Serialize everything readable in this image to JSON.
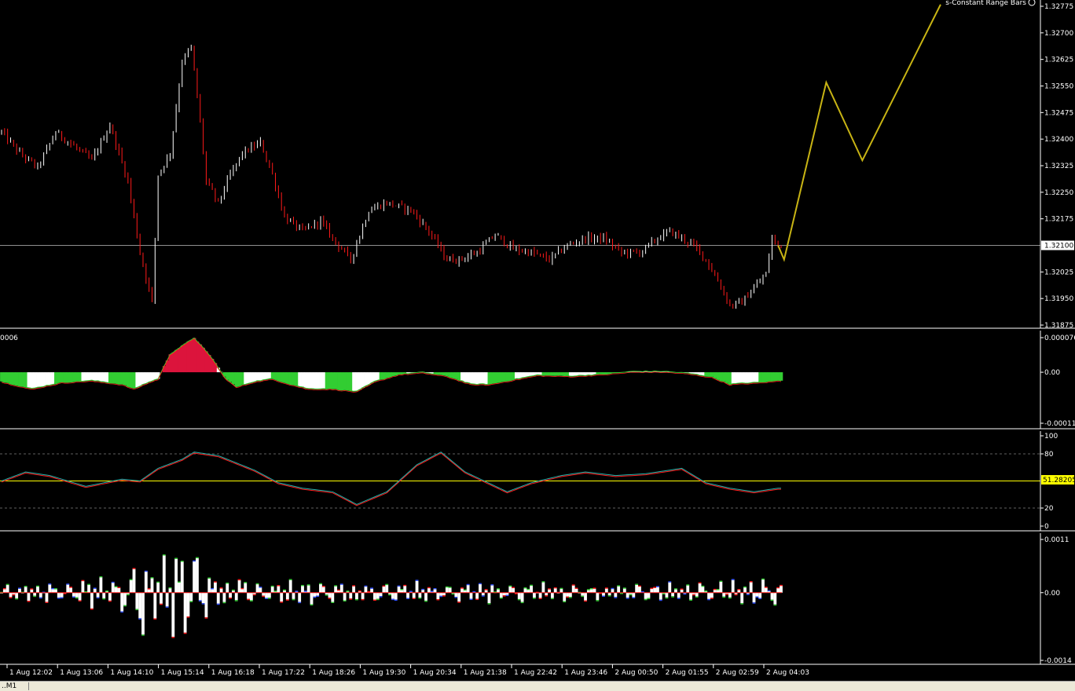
{
  "window": {
    "corner_title": "s-Constant Range Bars",
    "timeframe_tab": "..M1"
  },
  "colors": {
    "background": "#000000",
    "candle_up": "#ffffff",
    "candle_down": "#ff1a1a",
    "projection": "#c8b414",
    "hist_positive": "#dc143c",
    "hist_negative": "#32cd32",
    "hist_fill": "#ffffff",
    "signal_line": "#32cd32",
    "level_line": "#ffff00"
  },
  "chart_data": [
    {
      "type": "candlestick",
      "title": "s-Constant Range Bars",
      "ylim": [
        1.31875,
        1.32775
      ],
      "y_ticks": [
        "1.32775",
        "1.32700",
        "1.32625",
        "1.32550",
        "1.32475",
        "1.32400",
        "1.32325",
        "1.32250",
        "1.32175",
        "1.32025",
        "1.31950",
        "1.31875"
      ],
      "current_price": "1.32100",
      "bars": 260,
      "price_path": [
        [
          0,
          1.3242
        ],
        [
          6,
          1.3236
        ],
        [
          12,
          1.3232
        ],
        [
          18,
          1.3242
        ],
        [
          24,
          1.3238
        ],
        [
          30,
          1.3234
        ],
        [
          36,
          1.3244
        ],
        [
          42,
          1.3228
        ],
        [
          46,
          1.3208
        ],
        [
          50,
          1.3194
        ],
        [
          52,
          1.323
        ],
        [
          56,
          1.3236
        ],
        [
          60,
          1.3262
        ],
        [
          63,
          1.3266
        ],
        [
          66,
          1.3245
        ],
        [
          68,
          1.3228
        ],
        [
          72,
          1.3222
        ],
        [
          76,
          1.323
        ],
        [
          80,
          1.3236
        ],
        [
          86,
          1.3239
        ],
        [
          90,
          1.323
        ],
        [
          94,
          1.3218
        ],
        [
          100,
          1.3214
        ],
        [
          106,
          1.3217
        ],
        [
          110,
          1.3212
        ],
        [
          116,
          1.3206
        ],
        [
          122,
          1.322
        ],
        [
          128,
          1.3222
        ],
        [
          136,
          1.322
        ],
        [
          142,
          1.3214
        ],
        [
          148,
          1.3206
        ],
        [
          152,
          1.3206
        ],
        [
          158,
          1.3208
        ],
        [
          164,
          1.3213
        ],
        [
          170,
          1.3209
        ],
        [
          176,
          1.3208
        ],
        [
          182,
          1.3206
        ],
        [
          188,
          1.321
        ],
        [
          194,
          1.3212
        ],
        [
          200,
          1.3212
        ],
        [
          206,
          1.3208
        ],
        [
          212,
          1.3208
        ],
        [
          218,
          1.3212
        ],
        [
          222,
          1.3214
        ],
        [
          226,
          1.3212
        ],
        [
          230,
          1.321
        ],
        [
          234,
          1.3206
        ],
        [
          238,
          1.32
        ],
        [
          242,
          1.3193
        ],
        [
          246,
          1.3194
        ],
        [
          250,
          1.3198
        ],
        [
          254,
          1.3202
        ],
        [
          256,
          1.3212
        ],
        [
          258,
          1.321
        ]
      ],
      "projection_line": [
        [
          258,
          1.321
        ],
        [
          260,
          1.3206
        ],
        [
          274,
          1.3256
        ],
        [
          286,
          1.3234
        ],
        [
          312,
          1.3278
        ]
      ]
    },
    {
      "type": "histogram",
      "y_ticks": [
        "0.000076",
        "0.00",
        "-0.000112"
      ],
      "ylim": [
        -0.000112,
        7.6e-05
      ],
      "top_left_label": "0006",
      "oscillator_path": [
        [
          0,
          -2e-05
        ],
        [
          10,
          -3.6e-05
        ],
        [
          20,
          -2.2e-05
        ],
        [
          30,
          -1.8e-05
        ],
        [
          40,
          -2.6e-05
        ],
        [
          44,
          -3.6e-05
        ],
        [
          48,
          -2.4e-05
        ],
        [
          52,
          -1.4e-05
        ],
        [
          56,
          4e-05
        ],
        [
          64,
          7.6e-05
        ],
        [
          70,
          3e-05
        ],
        [
          74,
          -1e-05
        ],
        [
          78,
          -3.2e-05
        ],
        [
          84,
          -2e-05
        ],
        [
          90,
          -1.4e-05
        ],
        [
          96,
          -2.6e-05
        ],
        [
          102,
          -3.6e-05
        ],
        [
          110,
          -3.6e-05
        ],
        [
          118,
          -4.2e-05
        ],
        [
          124,
          -2e-05
        ],
        [
          132,
          -4e-06
        ],
        [
          140,
          0.0
        ],
        [
          148,
          -8e-06
        ],
        [
          156,
          -2.6e-05
        ],
        [
          162,
          -2.6e-05
        ],
        [
          170,
          -1.6e-05
        ],
        [
          178,
          -6e-06
        ],
        [
          190,
          -8e-06
        ],
        [
          200,
          -4e-06
        ],
        [
          210,
          2e-06
        ],
        [
          220,
          2e-06
        ],
        [
          228,
          -2e-06
        ],
        [
          236,
          -1e-05
        ],
        [
          242,
          -2.6e-05
        ],
        [
          246,
          -2.4e-05
        ],
        [
          252,
          -2.2e-05
        ],
        [
          258,
          -1.8e-05
        ]
      ]
    },
    {
      "type": "line",
      "y_ticks": [
        "100",
        "80",
        "20",
        "0"
      ],
      "ylim": [
        0,
        100
      ],
      "levels": [
        80,
        50,
        20
      ],
      "current_value": "51.28205",
      "oscillator_path": [
        [
          0,
          50
        ],
        [
          8,
          60
        ],
        [
          16,
          56
        ],
        [
          28,
          44
        ],
        [
          40,
          52
        ],
        [
          46,
          50
        ],
        [
          52,
          64
        ],
        [
          60,
          74
        ],
        [
          64,
          82
        ],
        [
          72,
          78
        ],
        [
          84,
          62
        ],
        [
          92,
          48
        ],
        [
          100,
          42
        ],
        [
          110,
          38
        ],
        [
          118,
          24
        ],
        [
          128,
          38
        ],
        [
          138,
          68
        ],
        [
          146,
          82
        ],
        [
          154,
          60
        ],
        [
          168,
          38
        ],
        [
          176,
          48
        ],
        [
          186,
          56
        ],
        [
          194,
          60
        ],
        [
          204,
          56
        ],
        [
          214,
          58
        ],
        [
          226,
          64
        ],
        [
          234,
          48
        ],
        [
          242,
          42
        ],
        [
          250,
          38
        ],
        [
          258,
          42
        ]
      ]
    },
    {
      "type": "histogram",
      "y_ticks": [
        "0.0011",
        "0.00",
        "-0.0014"
      ],
      "ylim": [
        -0.0014,
        0.0011
      ],
      "amplitude_profile": [
        [
          0,
          0.00018
        ],
        [
          20,
          0.00022
        ],
        [
          40,
          0.0004
        ],
        [
          44,
          0.0008
        ],
        [
          46,
          0.0013
        ],
        [
          50,
          0.0006
        ],
        [
          56,
          0.0009
        ],
        [
          62,
          0.0011
        ],
        [
          66,
          0.0007
        ],
        [
          72,
          0.0004
        ],
        [
          90,
          0.00025
        ],
        [
          140,
          0.00022
        ],
        [
          200,
          0.00018
        ],
        [
          240,
          0.00024
        ],
        [
          258,
          0.0003
        ]
      ]
    }
  ],
  "time_axis": {
    "labels": [
      "1 Aug 12:02",
      "1 Aug 13:06",
      "1 Aug 14:10",
      "1 Aug 15:14",
      "1 Aug 16:18",
      "1 Aug 17:22",
      "1 Aug 18:26",
      "1 Aug 19:30",
      "1 Aug 20:34",
      "1 Aug 21:38",
      "1 Aug 22:42",
      "1 Aug 23:46",
      "2 Aug 00:50",
      "2 Aug 01:55",
      "2 Aug 02:59",
      "2 Aug 04:03"
    ]
  }
}
